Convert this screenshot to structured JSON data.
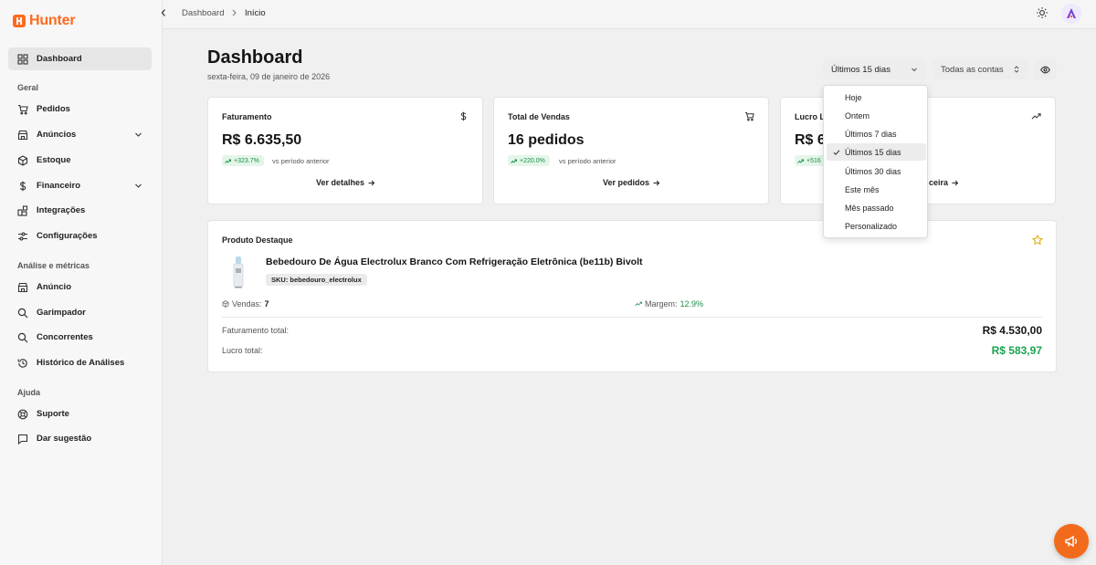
{
  "brand": {
    "name": "Hunter",
    "color": "#ff6a1f"
  },
  "sidebar": {
    "items": [
      {
        "label": "Dashboard",
        "icon": "grid-icon"
      },
      {
        "label": "Pedidos",
        "icon": "cart-icon"
      },
      {
        "label": "Anúncios",
        "icon": "store-icon"
      },
      {
        "label": "Estoque",
        "icon": "box-icon"
      },
      {
        "label": "Financeiro",
        "icon": "dollar-icon"
      },
      {
        "label": "Integrações",
        "icon": "puzzle-icon"
      },
      {
        "label": "Configurações",
        "icon": "sliders-icon"
      },
      {
        "label": "Anúncio",
        "icon": "store-icon"
      },
      {
        "label": "Garimpador",
        "icon": "search-icon"
      },
      {
        "label": "Concorrentes",
        "icon": "search-icon"
      },
      {
        "label": "Histórico de Análises",
        "icon": "history-icon"
      },
      {
        "label": "Suporte",
        "icon": "lifebuoy-icon"
      },
      {
        "label": "Dar sugestão",
        "icon": "message-icon"
      }
    ],
    "sections": [
      "Geral",
      "Análise e métricas",
      "Ajuda"
    ]
  },
  "topbar": {
    "breadcrumb": [
      "Dashboard",
      "Início"
    ]
  },
  "header": {
    "title": "Dashboard",
    "date": "sexta-feira, 09 de janeiro de 2026",
    "period": "Últimos 15 dias",
    "accounts": "Todas as contas"
  },
  "cards": [
    {
      "label": "Faturamento",
      "value": "R$ 6.635,50",
      "change": "+323.7%",
      "vs": "vs período anterior",
      "link": "Ver detalhes"
    },
    {
      "label": "Total de Vendas",
      "value": "16 pedidos",
      "change": "+220.0%",
      "vs": "vs período anterior",
      "link": "Ver pedidos"
    },
    {
      "label": "Lucro L",
      "value": "R$ 6",
      "change": "+516",
      "link": "ceira"
    }
  ],
  "product": {
    "section": "Produto Destaque",
    "name": "Bebedouro De Água Electrolux Branco Com Refrigeração Eletrônica (be11b) Bivolt",
    "sku": "SKU: bebedouro_electrolux",
    "sales_label": "Vendas:",
    "sales_value": "7",
    "margin_label": "Margem:",
    "margin_value": "12.9%",
    "revenue_label": "Faturamento total:",
    "revenue_value": "R$ 4.530,00",
    "profit_label": "Lucro total:",
    "profit_value": "R$ 583,97"
  },
  "dropdown": {
    "options": [
      "Hoje",
      "Ontem",
      "Últimos 7 dias",
      "Últimos 15 dias",
      "Últimos 30 dias",
      "Este mês",
      "Mês passado",
      "Personalizado"
    ],
    "selected": "Últimos 15 dias"
  },
  "colors": {
    "accent": "#f26a1b",
    "positive": "#1b8f47",
    "positive_bg": "#e4f6ea"
  }
}
